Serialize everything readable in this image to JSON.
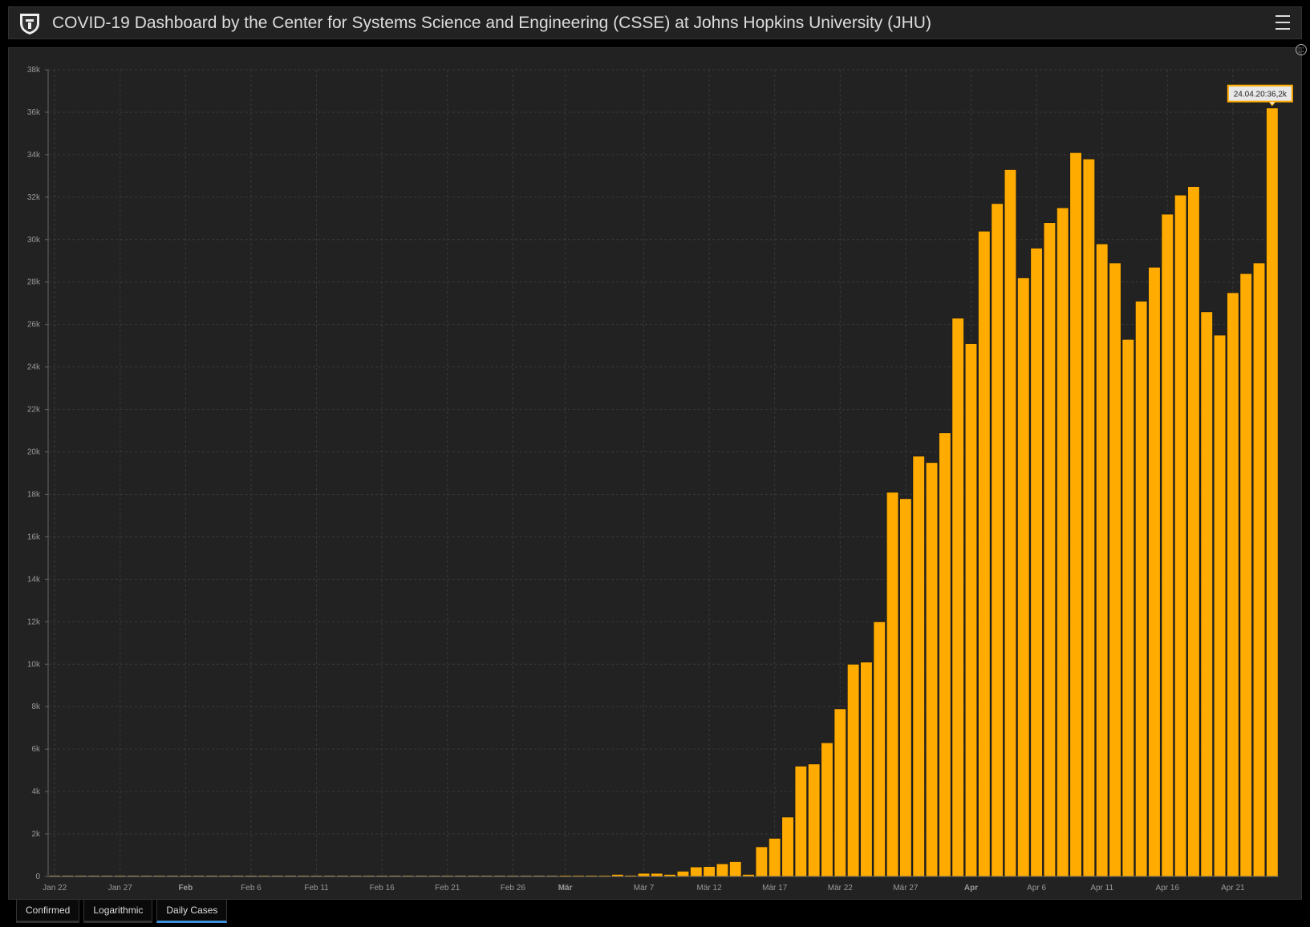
{
  "header": {
    "title": "COVID-19 Dashboard by the Center for Systems Science and Engineering (CSSE) at Johns Hopkins University (JHU)",
    "logo_icon": "jhu-shield-logo",
    "menu_icon": "hamburger-menu-icon"
  },
  "tabs": [
    {
      "label": "Confirmed",
      "active": false
    },
    {
      "label": "Logarithmic",
      "active": false
    },
    {
      "label": "Daily Cases",
      "active": true
    }
  ],
  "colors": {
    "bar": "#ffab00",
    "background": "#222222",
    "accent": "#3c8fd8"
  },
  "chart_data": {
    "type": "bar",
    "title": "",
    "xlabel": "",
    "ylabel": "",
    "ylim": [
      0,
      38000
    ],
    "yticks": [
      0,
      2000,
      4000,
      6000,
      8000,
      10000,
      12000,
      14000,
      16000,
      18000,
      20000,
      22000,
      24000,
      26000,
      28000,
      30000,
      32000,
      34000,
      36000,
      38000
    ],
    "ytick_labels": [
      "0",
      "2k",
      "4k",
      "6k",
      "8k",
      "10k",
      "12k",
      "14k",
      "16k",
      "18k",
      "20k",
      "22k",
      "24k",
      "26k",
      "28k",
      "30k",
      "32k",
      "34k",
      "36k",
      "38k"
    ],
    "start_date": "Jan 22",
    "xticks": [
      {
        "index": 0,
        "label": "Jan 22",
        "bold": false
      },
      {
        "index": 5,
        "label": "Jan 27",
        "bold": false
      },
      {
        "index": 10,
        "label": "Feb",
        "bold": true
      },
      {
        "index": 15,
        "label": "Feb 6",
        "bold": false
      },
      {
        "index": 20,
        "label": "Feb 11",
        "bold": false
      },
      {
        "index": 25,
        "label": "Feb 16",
        "bold": false
      },
      {
        "index": 30,
        "label": "Feb 21",
        "bold": false
      },
      {
        "index": 35,
        "label": "Feb 26",
        "bold": false
      },
      {
        "index": 39,
        "label": "Mär",
        "bold": true
      },
      {
        "index": 45,
        "label": "Mär 7",
        "bold": false
      },
      {
        "index": 50,
        "label": "Mär 12",
        "bold": false
      },
      {
        "index": 55,
        "label": "Mär 17",
        "bold": false
      },
      {
        "index": 60,
        "label": "Mär 22",
        "bold": false
      },
      {
        "index": 65,
        "label": "Mär 27",
        "bold": false
      },
      {
        "index": 70,
        "label": "Apr",
        "bold": true
      },
      {
        "index": 75,
        "label": "Apr 6",
        "bold": false
      },
      {
        "index": 80,
        "label": "Apr 11",
        "bold": false
      },
      {
        "index": 85,
        "label": "Apr 16",
        "bold": false
      },
      {
        "index": 90,
        "label": "Apr 21",
        "bold": false
      }
    ],
    "values": [
      0,
      0,
      1,
      0,
      3,
      0,
      1,
      2,
      0,
      0,
      0,
      1,
      0,
      0,
      0,
      0,
      0,
      1,
      0,
      0,
      0,
      0,
      0,
      0,
      0,
      0,
      0,
      0,
      0,
      0,
      0,
      0,
      0,
      0,
      0,
      0,
      0,
      1,
      2,
      20,
      40,
      50,
      50,
      100,
      60,
      150,
      150,
      100,
      250,
      450,
      470,
      600,
      700,
      100,
      1400,
      1800,
      2800,
      5200,
      5300,
      6300,
      7900,
      10000,
      10100,
      12000,
      18100,
      17800,
      19800,
      19500,
      20900,
      26300,
      25100,
      30400,
      31700,
      33300,
      28200,
      29600,
      30800,
      31500,
      34100,
      33800,
      29800,
      28900,
      25300,
      27100,
      28700,
      31200,
      32100,
      32500,
      26600,
      25500,
      27500,
      28400,
      28900,
      36200
    ],
    "tooltip": {
      "index": 93,
      "label": "24.04.20:36,2k"
    },
    "grid": true,
    "legend": "none"
  }
}
